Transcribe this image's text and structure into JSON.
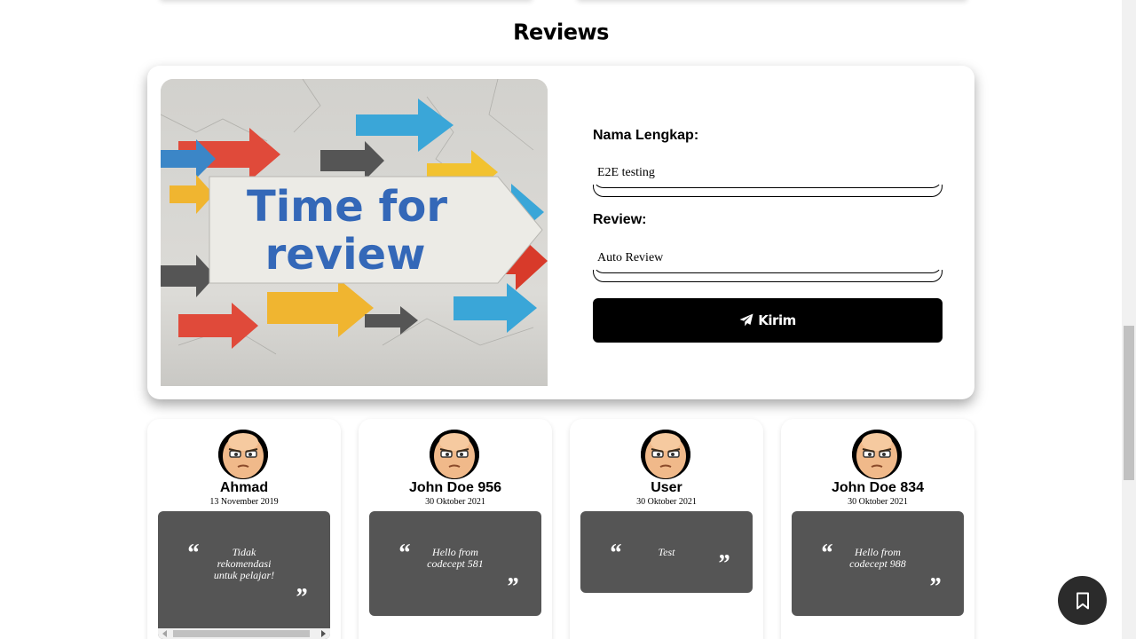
{
  "section": {
    "title": "Reviews"
  },
  "form": {
    "image_caption_line1": "Time for",
    "image_caption_line2": "review",
    "name_label": "Nama Lengkap:",
    "name_value": "E2E testing",
    "review_label": "Review:",
    "review_value": "Auto Review",
    "submit_label": "Kirim",
    "submit_icon": "paper-plane-icon"
  },
  "reviews": [
    {
      "name": "Ahmad",
      "date": "13 November 2019",
      "text": "Tidak rekomendasi untuk pelajar!"
    },
    {
      "name": "John Doe 956",
      "date": "30 Oktober 2021",
      "text": "Hello from codecept 581"
    },
    {
      "name": "User",
      "date": "30 Oktober 2021",
      "text": "Test"
    },
    {
      "name": "John Doe 834",
      "date": "30 Oktober 2021",
      "text": "Hello from codecept 988"
    }
  ],
  "quote_marks": {
    "open": "“",
    "close": "”"
  },
  "fab": {
    "icon": "bookmark-icon"
  }
}
